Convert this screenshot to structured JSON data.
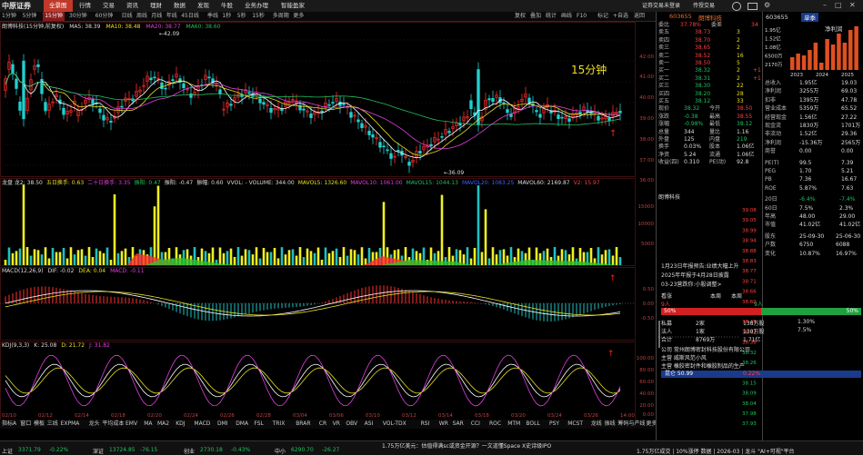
{
  "app": {
    "logo": "中原证券"
  },
  "topnav": [
    {
      "label": "全景图",
      "active": true
    },
    {
      "label": "行情"
    },
    {
      "label": "交易"
    },
    {
      "label": "资讯"
    },
    {
      "label": "理财"
    },
    {
      "label": "数据"
    },
    {
      "label": "发现"
    },
    {
      "label": "牛股"
    },
    {
      "label": "业务办理"
    },
    {
      "label": "智能盈家"
    }
  ],
  "topright": {
    "account": "证券交易未登录",
    "bulletin": "传授交易",
    "icons": [
      "user-icon",
      "message-icon",
      "settings-icon",
      "minimize-icon",
      "maximize-icon",
      "close-icon"
    ]
  },
  "periods": [
    "1分钟",
    "5分钟",
    "15分钟",
    "30分钟",
    "60分钟",
    "日线",
    "周线",
    "月线",
    "年线",
    "45日线",
    "季线",
    "1秒",
    "5秒",
    "15秒",
    "多周期",
    "更多"
  ],
  "period_selected": "15分钟",
  "toolbar_right": [
    "复权",
    "叠加",
    "统计",
    "画线",
    "F10",
    "标记",
    "+自选",
    "返回"
  ],
  "chart_header": {
    "name": "朗博科技(15分钟,前复权)",
    "ma5": "MA5: 38.39",
    "ma10": "MA10: 38.48",
    "ma20": "MA20: 38.77",
    "ma60": "MA60: 38.60"
  },
  "price_axis": [
    "42.00",
    "41.00",
    "40.00",
    "39.00",
    "38.00",
    "37.00",
    "36.00"
  ],
  "annotations": {
    "high": "42.09",
    "low": "36.09",
    "period_label": "15分钟"
  },
  "vol_header": {
    "a": "龙盘 龙2: 38.50",
    "b": "五日换手: 0.63",
    "c": "二十日换手: 3.35",
    "d": "振阳: 0.47",
    "e": "振阳: -0.47",
    "f": "振幅: 0.60",
    "g": "VVOL: - VOLUME: 344.00",
    "h": "MAVOL5: 1326.60",
    "i": "MAVOL10: 1061.00",
    "j": "MAVOL15: 1044.13",
    "k": "MAVOL20: 1083.25",
    "l": "MAVOL60: 2169.87",
    "m": "V2: 15.97",
    "n": "成: 0.61"
  },
  "vol_axis": [
    "15000",
    "10000",
    "5000"
  ],
  "macd_header": {
    "title": "MACD(12,26,9)",
    "dif": "DIF: -0.02",
    "dea": "DEA: 0.04",
    "macd": "MACD: -0.11"
  },
  "macd_axis": [
    "0.50",
    "0.00",
    "-0.50"
  ],
  "kdj_header": {
    "title": "KDJ(9,3,3)",
    "k": "K: 25.08",
    "d": "D: 21.72",
    "j": "J: 31.82"
  },
  "kdj_axis": [
    "100.00",
    "80.00",
    "60.00",
    "40.00",
    "20.00",
    "0.00"
  ],
  "time_axis": [
    "02/10",
    "02/12",
    "02/14",
    "02/18",
    "02/20",
    "02/24",
    "02/26",
    "02/28",
    "03/04",
    "03/06",
    "03/10",
    "03/12",
    "03/14",
    "03/18",
    "03/20",
    "03/24",
    "03/26",
    "14:00"
  ],
  "indicator_tabs": [
    "指标A",
    "窗口",
    "模板",
    "三线",
    "EXPMA",
    "龙头",
    "平均成本",
    "EMV",
    "MA",
    "MA2",
    "KDJ",
    "MACD",
    "DMI",
    "DMA",
    "FSL",
    "TRIX",
    "BRAR",
    "CR",
    "VR",
    "OBV",
    "ASI",
    "VOL-TDX",
    "RSI",
    "WR",
    "SAR",
    "CCI",
    "ROC",
    "MTM",
    "BOLL",
    "PSY",
    "MCST",
    "龙线",
    "振线",
    "筹码与产线",
    "更多",
    "设置"
  ],
  "book": {
    "code": "603655",
    "name": "朗博科技",
    "weibi": {
      "label": "委比",
      "val": "37.78%",
      "lbl2": "委差",
      "val2": "34"
    },
    "asks": [
      {
        "l": "卖五",
        "p": "38.73",
        "v": "3"
      },
      {
        "l": "卖四",
        "p": "38.70",
        "v": "2"
      },
      {
        "l": "卖三",
        "p": "38.65",
        "v": "2"
      },
      {
        "l": "卖二",
        "p": "38.52",
        "v": "16"
      },
      {
        "l": "卖一",
        "p": "38.50",
        "v": "5"
      }
    ],
    "bids": [
      {
        "l": "买一",
        "p": "38.32",
        "v": "2",
        "c": "+1"
      },
      {
        "l": "买二",
        "p": "38.31",
        "v": "2",
        "c": "+1"
      },
      {
        "l": "买三",
        "p": "38.30",
        "v": "22"
      },
      {
        "l": "买四",
        "p": "38.20",
        "v": "28"
      },
      {
        "l": "买五",
        "p": "38.12",
        "v": "33"
      }
    ],
    "stats": [
      {
        "a": "现价",
        "av": "38.32",
        "b": "今开",
        "bv": "38.50"
      },
      {
        "a": "涨跌",
        "av": "-0.38",
        "b": "最高",
        "bv": "38.55"
      },
      {
        "a": "涨幅",
        "av": "-0.98%",
        "b": "最低",
        "bv": "38.12"
      },
      {
        "a": "总量",
        "av": "344",
        "b": "量比",
        "bv": "1.16"
      },
      {
        "a": "外盘",
        "av": "125",
        "b": "内盘",
        "bv": "219"
      },
      {
        "a": "换手",
        "av": "0.03%",
        "b": "股本",
        "bv": "1.06亿"
      },
      {
        "a": "净资",
        "av": "5.24",
        "b": "流通",
        "bv": "1.06亿"
      },
      {
        "a": "收益(四)",
        "av": "0.310",
        "b": "PE(动)",
        "bv": "92.8"
      }
    ],
    "tick_name": "朗博科技",
    "tick_axis": [
      "39.08",
      "39.05",
      "38.99",
      "38.94",
      "38.88",
      "38.83",
      "38.77",
      "38.71",
      "38.66",
      "38.60",
      "38.54",
      "38.49",
      "38.43",
      "38.38",
      "38.32",
      "38.26",
      "38.21",
      "38.15",
      "38.09",
      "38.04",
      "37.98",
      "37.93"
    ]
  },
  "far": {
    "code": "603655",
    "tab1": "单季",
    "tab2": "净利润",
    "yaxis": [
      "1.95亿",
      "1.52亿",
      "1.08亿",
      "6500万",
      "2170万"
    ],
    "years": [
      "2023",
      "2024",
      "2025"
    ],
    "fin": [
      {
        "a": "总收入",
        "b": "1.95亿",
        "c": "19.03"
      },
      {
        "a": "净利润",
        "b": "3255万",
        "c": "69.03"
      },
      {
        "a": "扣非",
        "b": "1395万",
        "c": "47.78"
      },
      {
        "a": "营业成本",
        "b": "5359万",
        "c": "65.52"
      },
      {
        "a": "经营现金",
        "b": "1.56亿",
        "c": "27.22"
      },
      {
        "a": "现金流",
        "b": "1830万",
        "c": "1701万"
      },
      {
        "a": "非流动",
        "b": "1.52亿",
        "c": "29.36"
      },
      {
        "a": "净利润",
        "b": "-15.36万",
        "c": "2565万"
      },
      {
        "a": "商誉",
        "b": "0.00",
        "c": "0.00"
      }
    ],
    "val": [
      {
        "a": "PE(T)",
        "b": "99.5",
        "c": "7.39"
      },
      {
        "a": "PEG",
        "b": "1.70",
        "c": "5.21"
      },
      {
        "a": "PB",
        "b": "7.36",
        "c": "16.67"
      },
      {
        "a": "ROE",
        "b": "5.87%",
        "c": "7.63"
      }
    ],
    "perf": [
      {
        "a": "20日",
        "b": "-6.4%",
        "c": "-7.4%"
      },
      {
        "a": "60日",
        "b": "7.5%",
        "c": "2.3%"
      },
      {
        "a": "年高",
        "b": "48.00",
        "c": "29.00"
      },
      {
        "a": "市值",
        "b": "41.02亿",
        "c": "41.02亿"
      }
    ],
    "holders": [
      {
        "a": "股东",
        "b": "25-09-30",
        "c": "25-06-30"
      },
      {
        "a": "户数",
        "b": "6750",
        "c": "6088"
      },
      {
        "a": "变化",
        "b": "10.87%",
        "c": "16.97%"
      }
    ],
    "news": [
      "1月23日年报预告:业绩大幅上升",
      "2025年年报于4月28日披露",
      "03-23营跌你:小股调整>"
    ],
    "sentiment": {
      "label": "看涨",
      "sub1": "本周",
      "sub2": "本周",
      "left": "9人",
      "right": "9人",
      "lp": "50%",
      "rp": "50%"
    },
    "org": [
      {
        "a": "私募",
        "b": "2家",
        "c": "138万股",
        "d": "1.30%"
      },
      {
        "a": "法人",
        "b": "1家",
        "c": "130万股",
        "d": "7.5%"
      },
      {
        "a": "合计",
        "b": "8769万",
        "c": "1.71亿"
      }
    ],
    "company": [
      "公司 常州朗博密封科技股份有限公司",
      "主营 威斯风范小风",
      "主营 橡胶密封件和橡胶制品的生产"
    ],
    "bottom": {
      "a": "昆仑 50.99",
      "b": "0.22%"
    }
  },
  "status": [
    {
      "t": "上证",
      "v": "3371.79",
      "c": "-0.22%",
      "cls": "grn"
    },
    {
      "t": "深证",
      "v": "13724.85",
      "c": "-76.15",
      "cls": "grn"
    },
    {
      "t": "创业",
      "v": "2730.18",
      "c": "-0.43%",
      "cls": "grn"
    },
    {
      "t": "中小",
      "v": "6290.70",
      "c": "-26.27",
      "cls": "grn"
    }
  ],
  "status_right": "1.75万亿成交 | 10%涨停 数据 | 2026-03 | 龙斗 \"AI+可视\"平台",
  "ticker": "1.75万亿美元：估值得满sc或资金开源？一文道懂Space X史诗级IPO"
}
